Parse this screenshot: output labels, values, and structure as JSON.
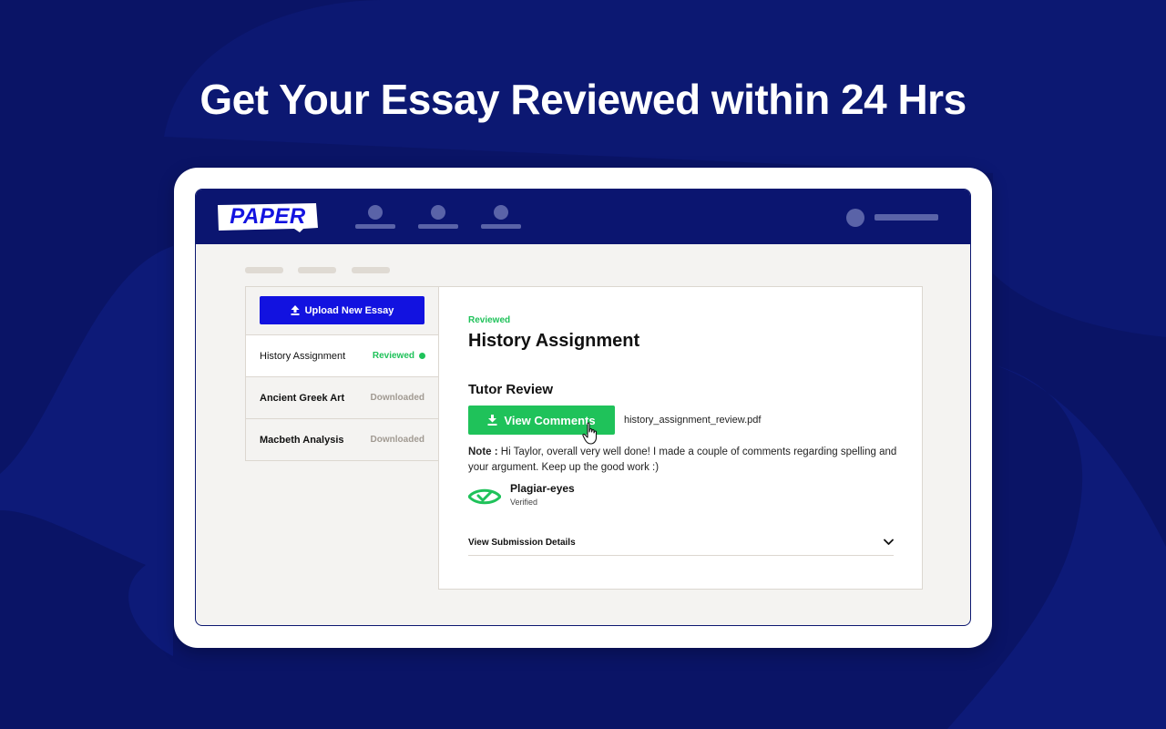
{
  "page": {
    "headline": "Get Your Essay Reviewed within 24 Hrs"
  },
  "colors": {
    "background": "#0a1466",
    "accent_blue": "#1212e0",
    "accent_green": "#1fc25a"
  },
  "app": {
    "logo": "PAPER",
    "nav_icons": [
      "user-placeholder-icon",
      "user-placeholder-icon",
      "user-placeholder-icon"
    ]
  },
  "sidebar": {
    "upload_label": "Upload New Essay",
    "items": [
      {
        "name": "History Assignment",
        "status": "Reviewed"
      },
      {
        "name": "Ancient Greek Art",
        "status": "Downloaded"
      },
      {
        "name": "Macbeth Analysis",
        "status": "Downloaded"
      }
    ]
  },
  "main": {
    "status": "Reviewed",
    "title": "History Assignment",
    "section_title": "Tutor Review",
    "view_button": "View Comments",
    "file_name": "history_assignment_review.pdf",
    "note_label": "Note :",
    "note_text": " Hi Taylor, overall very well done! I made a couple of comments regarding spelling and your argument. Keep up the good work :)",
    "plagiarism": {
      "name": "Plagiar-eyes",
      "status": "Verified"
    },
    "details_label": "View Submission Details"
  }
}
